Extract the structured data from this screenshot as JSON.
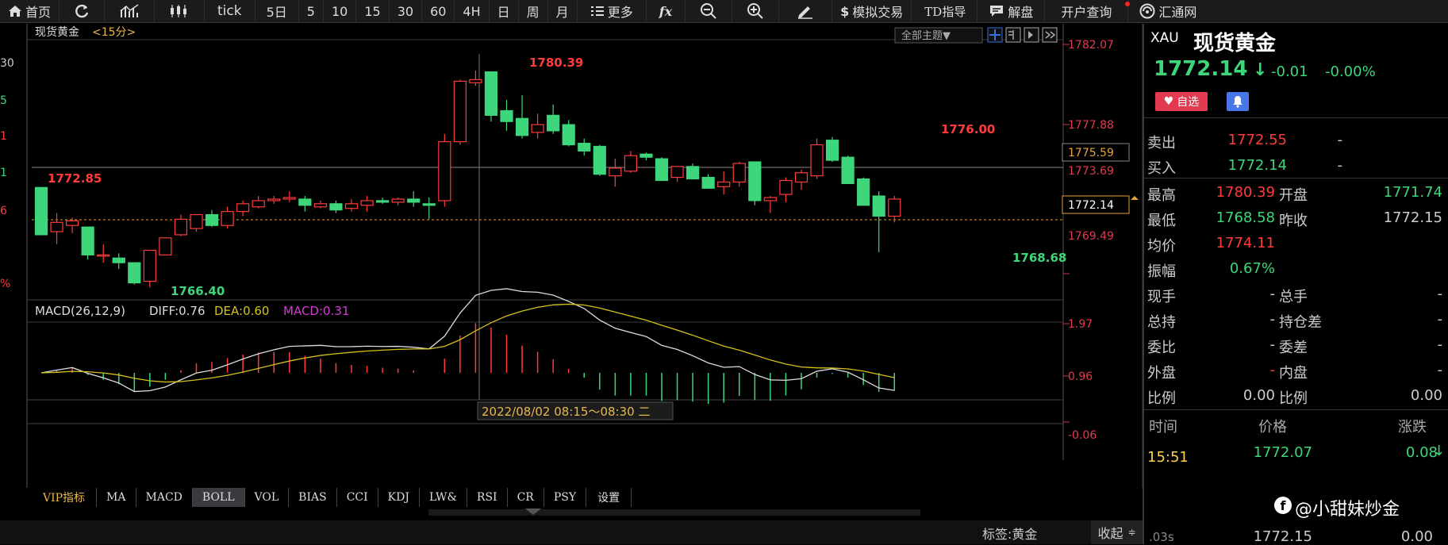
{
  "toolbar": {
    "home": "首页",
    "tick": "tick",
    "periods": [
      "5日",
      "5",
      "10",
      "15",
      "30",
      "60",
      "4H",
      "日",
      "周",
      "月"
    ],
    "more": "更多",
    "fx": "fx",
    "sim_trade": "模拟交易",
    "td_guide": "TD指导",
    "analysis": "解盘",
    "account": "开户查询",
    "brand": "汇通网"
  },
  "chart": {
    "title": "现货黄金",
    "period": "<15分>",
    "theme_button": "全部主题▼",
    "price_labels": [
      "1782.07",
      "1777.88",
      "1775.59",
      "1773.69",
      "1772.14",
      "1769.49"
    ],
    "annotations": {
      "high": "1780.39",
      "left_high": "1772.85",
      "low_left": "1766.40",
      "right_high": "1776.00",
      "right_low": "1768.68"
    },
    "left_cut_labels": [
      "30",
      "5",
      "1",
      "1",
      "6",
      "%"
    ],
    "crosshair_time": "2022/08/02 08:15～08:30 二",
    "macd_title": "MACD(26,12,9)",
    "diff_label": "DIFF:0.76",
    "dea_label": "DEA:0.60",
    "macd_label": "MACD:0.31",
    "macd_axis": [
      "1.97",
      "0.96",
      "-0.06"
    ]
  },
  "chart_data": {
    "type": "candlestick",
    "title": "现货黄金 <15分>",
    "ylim": [
      1765.5,
      1782.5
    ],
    "candles": [
      [
        1772.85,
        1772.85,
        1769.8,
        1769.8
      ],
      [
        1770.0,
        1771.2,
        1769.2,
        1770.6
      ],
      [
        1770.4,
        1770.9,
        1769.9,
        1770.7
      ],
      [
        1770.3,
        1770.3,
        1768.2,
        1768.5
      ],
      [
        1768.5,
        1769.2,
        1768.0,
        1768.5
      ],
      [
        1768.3,
        1768.6,
        1767.6,
        1768.0
      ],
      [
        1768.0,
        1768.0,
        1766.6,
        1766.7
      ],
      [
        1766.8,
        1768.8,
        1766.4,
        1768.8
      ],
      [
        1768.5,
        1769.6,
        1768.5,
        1769.6
      ],
      [
        1769.8,
        1771.1,
        1769.7,
        1770.8
      ],
      [
        1770.2,
        1771.1,
        1770.0,
        1771.1
      ],
      [
        1771.1,
        1771.4,
        1770.3,
        1770.4
      ],
      [
        1770.4,
        1771.6,
        1770.2,
        1771.3
      ],
      [
        1771.3,
        1772.0,
        1771.0,
        1771.8
      ],
      [
        1771.6,
        1772.3,
        1771.5,
        1772.0
      ],
      [
        1772.0,
        1772.3,
        1771.8,
        1772.1
      ],
      [
        1772.1,
        1772.6,
        1771.9,
        1772.2
      ],
      [
        1772.1,
        1772.3,
        1771.3,
        1771.7
      ],
      [
        1771.6,
        1772.0,
        1771.5,
        1771.8
      ],
      [
        1771.8,
        1772.0,
        1771.2,
        1771.4
      ],
      [
        1771.5,
        1772.1,
        1771.3,
        1771.8
      ],
      [
        1771.7,
        1772.3,
        1771.3,
        1772.0
      ],
      [
        1772.0,
        1772.2,
        1771.8,
        1771.9
      ],
      [
        1771.9,
        1772.2,
        1771.7,
        1772.1
      ],
      [
        1772.1,
        1772.6,
        1771.6,
        1771.9
      ],
      [
        1771.8,
        1772.2,
        1770.8,
        1771.7
      ],
      [
        1772.0,
        1776.3,
        1771.6,
        1775.8
      ],
      [
        1775.8,
        1779.8,
        1775.6,
        1779.7
      ],
      [
        1779.6,
        1780.39,
        1779.4,
        1779.8
      ],
      [
        1780.3,
        1780.3,
        1777.1,
        1777.5
      ],
      [
        1777.8,
        1778.5,
        1776.5,
        1777.1
      ],
      [
        1777.3,
        1778.8,
        1776.0,
        1776.2
      ],
      [
        1776.4,
        1777.6,
        1776.0,
        1776.9
      ],
      [
        1777.5,
        1778.2,
        1776.3,
        1776.5
      ],
      [
        1776.9,
        1777.2,
        1775.5,
        1775.6
      ],
      [
        1775.7,
        1776.0,
        1774.9,
        1775.2
      ],
      [
        1775.5,
        1775.6,
        1773.6,
        1773.7
      ],
      [
        1773.6,
        1774.7,
        1772.9,
        1774.1
      ],
      [
        1773.9,
        1775.2,
        1773.8,
        1774.9
      ],
      [
        1775.0,
        1775.1,
        1774.6,
        1774.8
      ],
      [
        1774.7,
        1774.8,
        1773.3,
        1773.3
      ],
      [
        1773.5,
        1774.2,
        1773.2,
        1774.2
      ],
      [
        1774.2,
        1774.4,
        1773.4,
        1773.4
      ],
      [
        1773.5,
        1773.7,
        1772.8,
        1772.8
      ],
      [
        1772.9,
        1773.9,
        1772.4,
        1773.2
      ],
      [
        1773.2,
        1774.5,
        1772.9,
        1774.4
      ],
      [
        1774.5,
        1774.5,
        1771.7,
        1772.0
      ],
      [
        1772.0,
        1772.3,
        1771.2,
        1772.2
      ],
      [
        1772.4,
        1773.5,
        1771.9,
        1773.3
      ],
      [
        1773.2,
        1774.0,
        1772.7,
        1773.8
      ],
      [
        1773.6,
        1776.0,
        1773.4,
        1775.6
      ],
      [
        1775.9,
        1776.1,
        1774.5,
        1774.6
      ],
      [
        1774.8,
        1774.9,
        1773.1,
        1773.1
      ],
      [
        1773.4,
        1773.5,
        1771.7,
        1771.7
      ],
      [
        1772.3,
        1772.6,
        1768.68,
        1771.0
      ],
      [
        1771.0,
        1772.3,
        1770.6,
        1772.1
      ]
    ],
    "macd": {
      "diff": 0.76,
      "dea": 0.6,
      "macd": 0.31
    }
  },
  "panel": {
    "symbol": "XAU",
    "name": "现货黄金",
    "price": "1772.14",
    "change": "-0.01",
    "change_pct": "-0.00%",
    "fav": "自选",
    "sell_label": "卖出",
    "sell_val": "1772.55",
    "sell_dash": "-",
    "buy_label": "买入",
    "buy_val": "1772.14",
    "buy_dash": "-",
    "rows": [
      {
        "l1": "最高",
        "v1": "1780.39",
        "c1": "red",
        "l2": "开盘",
        "v2": "1771.74",
        "c2": "green"
      },
      {
        "l1": "最低",
        "v1": "1768.58",
        "c1": "green",
        "l2": "昨收",
        "v2": "1772.15",
        "c2": "gray"
      },
      {
        "l1": "均价",
        "v1": "1774.11",
        "c1": "red",
        "l2": "",
        "v2": "",
        "c2": "gray"
      },
      {
        "l1": "振幅",
        "v1": "0.67%",
        "c1": "green",
        "l2": "",
        "v2": "",
        "c2": "gray"
      },
      {
        "l1": "现手",
        "v1": "-",
        "c1": "gray",
        "l2": "总手",
        "v2": "-",
        "c2": "gray"
      },
      {
        "l1": "总持",
        "v1": "-",
        "c1": "gray",
        "l2": "持仓差",
        "v2": "-",
        "c2": "gray"
      },
      {
        "l1": "委比",
        "v1": "-",
        "c1": "gray",
        "l2": "委差",
        "v2": "-",
        "c2": "gray"
      },
      {
        "l1": "外盘",
        "v1": "-",
        "c1": "red",
        "l2": "内盘",
        "v2": "-",
        "c2": "gray"
      },
      {
        "l1": "比例",
        "v1": "0.00",
        "c1": "gray",
        "l2": "比例",
        "v2": "0.00",
        "c2": "gray"
      }
    ],
    "ticks_header": {
      "time": "时间",
      "price": "价格",
      "change": "涨跌"
    },
    "tick1": {
      "time": "15:51",
      "price": "1772.07",
      "change": "0.08"
    },
    "tick2": {
      "time": ".03s",
      "price": "1772.15",
      "change": "0.00"
    },
    "watermark": "@小甜妹炒金"
  },
  "indicator_tabs": [
    "VIP指标",
    "MA",
    "MACD",
    "BOLL",
    "VOL",
    "BIAS",
    "CCI",
    "KDJ",
    "LW&",
    "RSI",
    "CR",
    "PSY",
    "设置"
  ],
  "status": {
    "tag": "标签:黄金",
    "collapse": "收起"
  },
  "colors": {
    "up": "#ff3b3b",
    "down": "#3ed67a",
    "dea": "#d4c21a",
    "diff": "#dddddd",
    "vip": "#e8b84a"
  }
}
